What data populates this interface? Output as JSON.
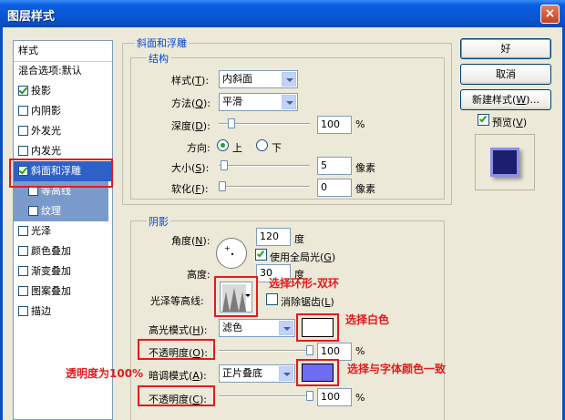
{
  "window": {
    "title": "图层样式",
    "close": "×"
  },
  "left_panel": {
    "items": [
      {
        "label": "样式",
        "checkbox": false
      },
      {
        "label": "混合选项:默认",
        "checkbox": false
      },
      {
        "label": "投影",
        "checkbox": true,
        "checked": true
      },
      {
        "label": "内阴影",
        "checkbox": true,
        "checked": false
      },
      {
        "label": "外发光",
        "checkbox": true,
        "checked": false
      },
      {
        "label": "内发光",
        "checkbox": true,
        "checked": false
      },
      {
        "label": "斜面和浮雕",
        "checkbox": true,
        "checked": true,
        "selected": true
      },
      {
        "label": "等高线",
        "checkbox": true,
        "checked": false,
        "sub": true
      },
      {
        "label": "纹理",
        "checkbox": true,
        "checked": false,
        "sub": true
      },
      {
        "label": "光泽",
        "checkbox": true,
        "checked": false
      },
      {
        "label": "颜色叠加",
        "checkbox": true,
        "checked": false
      },
      {
        "label": "渐变叠加",
        "checkbox": true,
        "checked": false
      },
      {
        "label": "图案叠加",
        "checkbox": true,
        "checked": false
      },
      {
        "label": "描边",
        "checkbox": true,
        "checked": false
      }
    ]
  },
  "bevel": {
    "group_title": "斜面和浮雕",
    "structure_title": "结构",
    "style_label": "样式(",
    "style_key": "T",
    "style_value": "内斜面",
    "technique_label": "方法(",
    "technique_key": "Q",
    "technique_value": "平滑",
    "depth_label": "深度(",
    "depth_key": "D",
    "depth_value": "100",
    "depth_unit": "%",
    "depth_fraction": 0.1,
    "direction_label": "方向:",
    "dir_up": "上",
    "dir_down": "下",
    "size_label": "大小(",
    "size_key": "S",
    "size_value": "5",
    "size_unit": "像素",
    "size_fraction": 0.02,
    "soften_label": "软化(",
    "soften_key": "F",
    "soften_value": "0",
    "soften_unit": "像素",
    "soften_fraction": 0.0
  },
  "shading": {
    "title": "阴影",
    "angle_label": "角度(",
    "angle_key": "N",
    "angle_value": "120",
    "angle_unit": "度",
    "global_light_label": "使用全局光(",
    "global_light_key": "G",
    "altitude_label": "高度:",
    "altitude_value": "30",
    "altitude_unit": "度",
    "gloss_label": "光泽等高线:",
    "antialias_label": "消除锯齿(",
    "antialias_key": "L",
    "highlight_mode_label": "高光模式(",
    "highlight_mode_key": "H",
    "highlight_mode_value": "滤色",
    "highlight_color": "#FFFFFF",
    "opacity1_label": "不透明度(",
    "opacity1_key": "O",
    "opacity1_value": "100",
    "opacity1_unit": "%",
    "opacity1_fraction": 1.0,
    "shadow_mode_label": "暗调模式(",
    "shadow_mode_key": "A",
    "shadow_mode_value": "正片叠底",
    "shadow_color": "#6E6CF2",
    "opacity2_label": "不透明度(",
    "opacity2_key": "C",
    "opacity2_value": "100",
    "opacity2_unit": "%",
    "opacity2_fraction": 1.0
  },
  "buttons": {
    "ok": "好",
    "cancel": "取消",
    "new_style": "新建样式(",
    "new_style_key": "W",
    "new_style_suffix": ")...",
    "preview": "预览(",
    "preview_key": "V"
  },
  "annotations": {
    "ring": "选择环形-双环",
    "white": "选择白色",
    "opacity": "透明度为100%",
    "match": "选择与字体颜色一致"
  },
  "colors": {
    "accent_red": "#E31B1B",
    "selected_row": "#2F60C8",
    "sub_row": "#7A9ACC"
  }
}
